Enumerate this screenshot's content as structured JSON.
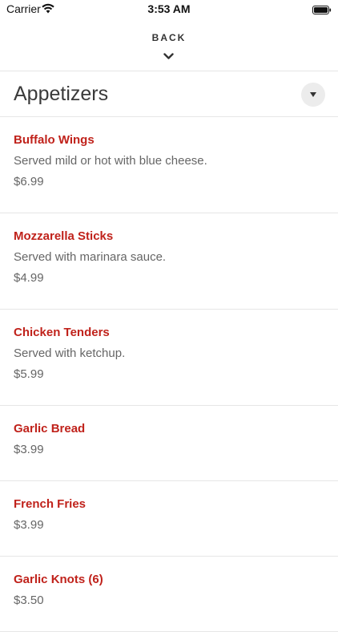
{
  "status_bar": {
    "carrier": "Carrier",
    "time": "3:53 AM",
    "wifi_icon": "wifi-icon",
    "battery_icon": "battery-icon"
  },
  "nav": {
    "back_label": "BACK",
    "back_icon": "chevron-down-icon"
  },
  "section": {
    "title": "Appetizers",
    "dropdown_icon": "triangle-down-icon"
  },
  "colors": {
    "item_name": "#c0221b",
    "text_secondary": "#666666",
    "divider": "#e6e6e6"
  },
  "menu_items": [
    {
      "name": "Buffalo Wings",
      "description": "Served mild or hot with blue cheese.",
      "price": "$6.99"
    },
    {
      "name": "Mozzarella Sticks",
      "description": "Served with marinara sauce.",
      "price": "$4.99"
    },
    {
      "name": "Chicken Tenders",
      "description": "Served with ketchup.",
      "price": "$5.99"
    },
    {
      "name": "Garlic Bread",
      "description": "",
      "price": "$3.99"
    },
    {
      "name": "French Fries",
      "description": "",
      "price": "$3.99"
    },
    {
      "name": "Garlic Knots (6)",
      "description": "",
      "price": "$3.50"
    }
  ]
}
